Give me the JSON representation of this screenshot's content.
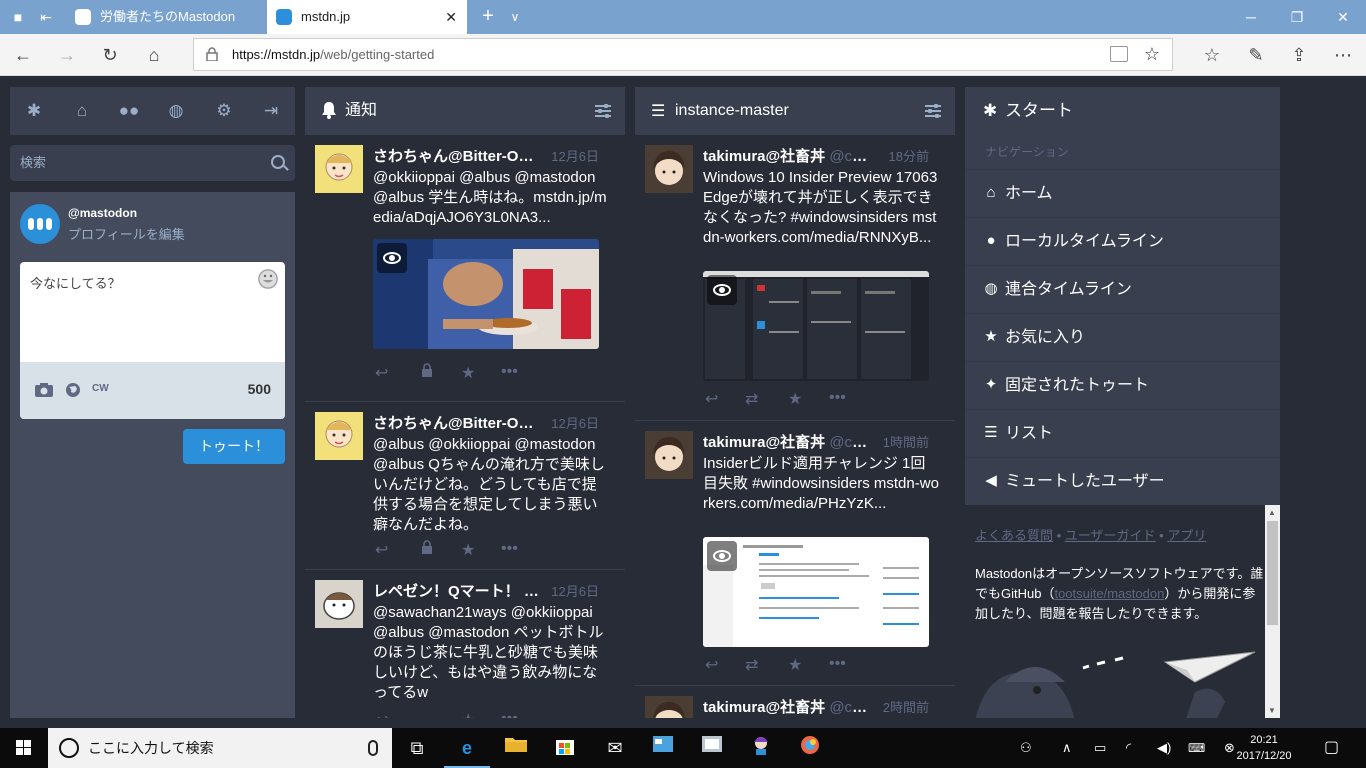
{
  "browser": {
    "tabs": [
      {
        "title": "労働者たちのMastodon",
        "active": false
      },
      {
        "title": "mstdn.jp",
        "active": true
      }
    ],
    "new_tab": "+",
    "url_host": "https://mstdn.jp",
    "url_path": "/web/getting-started",
    "accent": "#7aa2cf"
  },
  "sidebar": {
    "search_placeholder": "検索",
    "account_handle": "@mastodon",
    "edit_profile": "プロフィールを編集",
    "compose_placeholder": "今なにしてる？",
    "cw": "CW",
    "char_count": "500",
    "toot_button": "トゥート！"
  },
  "notifications": {
    "title": "通知",
    "items": [
      {
        "name": "さわちゃん@Bitter-Oran",
        "time": "12月6日",
        "content": "@okkiioppai @albus @mastodon @albus 学生ん時はね。mstdn.jp/media/aDqjAJO6Y3L0NA3..."
      },
      {
        "name": "さわちゃん@Bitter-Oran",
        "time": "12月6日",
        "content": "@albus @okkiioppai @mastodon @albus Qちゃんの淹れ方で美味しいんだけどね。どうしても店で提供する場合を想定してしまう悪い癖なんだよね。"
      },
      {
        "name": "レペゼン！Qマート！",
        "handle": "@...",
        "time": "12月6日",
        "content": "@sawachan21ways @okkiioppai @albus @mastodon ペットボトルのほうじ茶に牛乳と砂糖でも美味しいけど、もはや違う飲み物になってるw"
      }
    ]
  },
  "instance": {
    "title": "instance-master",
    "items": [
      {
        "name": "takimura@社畜丼",
        "handle": "@cv_k...",
        "time": "18分前",
        "content": "Windows 10 Insider Preview 17063 Edgeが壊れて丼が正しく表示できなくなった? #windowsinsiders  mstdn-workers.com/media/RNNXyB..."
      },
      {
        "name": "takimura@社畜丼",
        "handle": "@cv_k...",
        "time": "1時間前",
        "content": "Insiderビルド適用チャレンジ 1回目失敗 #windowsinsiders mstdn-workers.com/media/PHzYzK..."
      },
      {
        "name": "takimura@社畜丼",
        "handle": "@cv_k...",
        "time": "2時間前",
        "content": ""
      }
    ]
  },
  "getting_started": {
    "title": "スタート",
    "nav_heading": "ナビゲーション",
    "menu": [
      {
        "label": "ホーム",
        "icon": "home-icon"
      },
      {
        "label": "ローカルタイムライン",
        "icon": "users-icon"
      },
      {
        "label": "連合タイムライン",
        "icon": "globe-icon"
      },
      {
        "label": "お気に入り",
        "icon": "star-icon"
      },
      {
        "label": "固定されたトゥート",
        "icon": "pin-icon"
      },
      {
        "label": "リスト",
        "icon": "list-icon"
      },
      {
        "label": "ミュートしたユーザー",
        "icon": "mute-icon"
      }
    ],
    "link_faq": "よくある質問",
    "link_guide": "ユーザーガイド",
    "link_apps": "アプリ",
    "about_1": "Mastodonはオープンソースソフトウェアです。誰でもGitHub（",
    "about_link": "tootsuite/mastodon",
    "about_2": "）から開発に参加したり、問題を報告したりできます。"
  },
  "taskbar": {
    "search_text": "ここに入力して検索",
    "time": "20:21",
    "date": "2017/12/20"
  }
}
